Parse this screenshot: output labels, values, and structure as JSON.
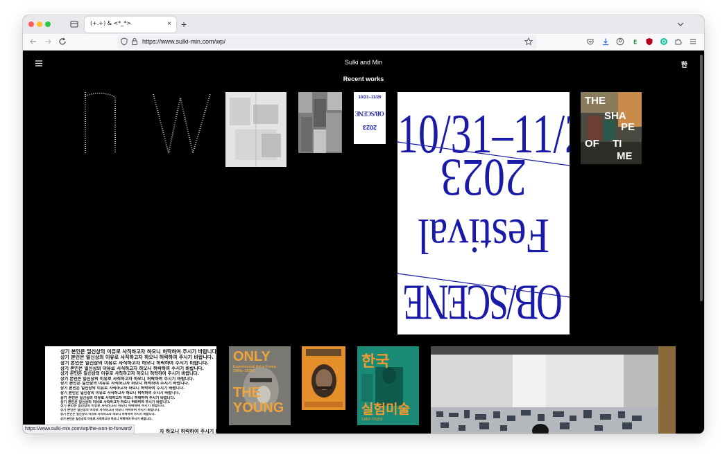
{
  "browser": {
    "tab_title": "(+.+) & <*_*>",
    "tab_close": "×",
    "new_tab": "+",
    "url": "https://www.sulki-min.com/wp/",
    "status_url": "https://www.sulki-min.com/wp/the-won-to-forward/"
  },
  "site": {
    "title": "Sulki and Min",
    "lang_toggle": "한",
    "section_title": "Recent works"
  },
  "works": {
    "obscene_poster": {
      "dates": "10/31–11/26",
      "year": "2023",
      "festival": "Festival",
      "name": "OB/SCENE"
    },
    "obscene_small": {
      "text": "OB/SCENE"
    },
    "shape_of_time": {
      "words": [
        "THE",
        "SHA",
        "PE",
        "OF",
        "TI",
        "ME"
      ]
    },
    "only_the_young": {
      "top": "ONLY",
      "sub": "Experimental Art in Korea, 1960s–1970s",
      "bottom": "THE YOUNG"
    },
    "korean_experimental": {
      "top": "한국",
      "bottom": "실험미술",
      "years": "1960-70년대"
    },
    "text_poster": {
      "lines": [
        "상기 본인은 일신상의 이유로 사직하고자 하오니 허락하여 주시기 바랍니다.",
        "상기 본인은 일신상의 이유로 사직하고자 하오니 허락하여 주시기 바랍니다.",
        "상기 본인은 일신상의 이유로 사직하고자 하오니 허락하여 주시기 바랍니다.",
        "상기 본인은 일신상의 이유로 사직하고자 하오니 허락하여 주시기 바랍니다.",
        "상기 본인은 일신상의 이유로 사직하고자 하오니 허락하여 주시기 바랍니다.",
        "상기 본인은 일신상의 이유로 사직하고자 하오니 허락하여 주시기 바랍니다.",
        "상기 본인은 일신상의 이유로 사직하고자 하오니 허락하여 주시기 바랍니다.",
        "상기 본인은 일신상의 이유로 사직하고자 하오니 허락하여 주시기 바랍니다.",
        "상기 본인은 일신상의 이유로 사직하고자 하오니 허락하여 주시기 바랍니다.",
        "상기 본인은 일신상의 이유로 사직하고자 하오니 허락하여 주시기 바랍니다.",
        "상기 본인은 일신상의 이유로 사직하고자 하오니 허락하여 주시기 바랍니다.",
        "상기 본인은 일신상의 이유로 사직하고자 하오니 허락하여 주시기 바랍니다.",
        "상기 본인은 일신상의 이유로 사직하고자 하오니 허락하여 주시기 바랍니다.",
        "상기 본인은 일신상의 이유로 사직하고자 하오니 허락하여 주시기 바랍니다.",
        "상기 본인은 일신상의 이유로 사직하고자 하오니 허락하여 주시기 바랍니다."
      ],
      "partial": "자 하오니 허락하여 주시기 바랍니다."
    }
  },
  "colors": {
    "page_bg": "#000000",
    "obscene_blue": "#1a1aa8",
    "only_orange": "#f0a53a",
    "korea_green": "#1b8c78",
    "korea_orange": "#f29a2e"
  },
  "icons": [
    "tab-list-icon",
    "back-icon",
    "forward-icon",
    "reload-icon",
    "shield-icon",
    "lock-icon",
    "bookmark-star-icon",
    "pocket-icon",
    "download-icon",
    "account-icon",
    "extension-icons",
    "hamburger-menu-icon"
  ]
}
